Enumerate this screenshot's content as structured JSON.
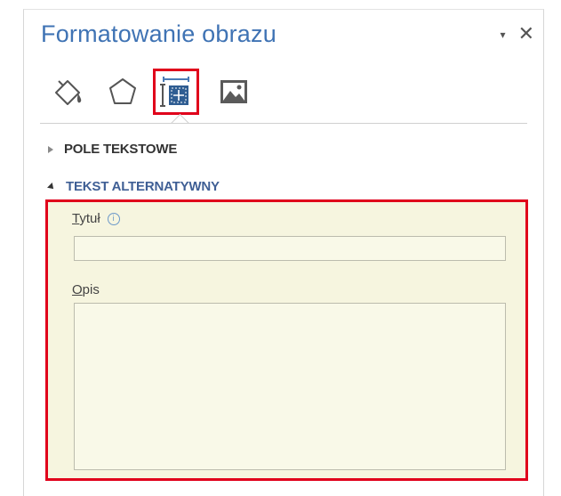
{
  "pane": {
    "title": "Formatowanie obrazu",
    "dropdown_glyph": "▾",
    "close_glyph": "✕"
  },
  "tabs": [
    {
      "icon": "fill-line-icon",
      "selected": false
    },
    {
      "icon": "effects-icon",
      "selected": false
    },
    {
      "icon": "layout-properties-icon",
      "selected": true,
      "highlighted": true
    },
    {
      "icon": "picture-icon",
      "selected": false
    }
  ],
  "sections": {
    "pole_tekstowe": {
      "label": "POLE TEKSTOWE",
      "expanded": false
    },
    "tekst_alternatywny": {
      "label": "TEKST ALTERNATYWNY",
      "expanded": true
    }
  },
  "alt_text": {
    "title_label_accel": "T",
    "title_label_rest": "ytuł",
    "info_glyph": "i",
    "title_value": "",
    "desc_label_accel": "O",
    "desc_label_rest": "pis",
    "desc_value": ""
  },
  "colors": {
    "title": "#3f73b4",
    "section_expanded": "#3f5f95",
    "highlight": "#e0001b",
    "alt_region_bg": "#f6f5df"
  }
}
